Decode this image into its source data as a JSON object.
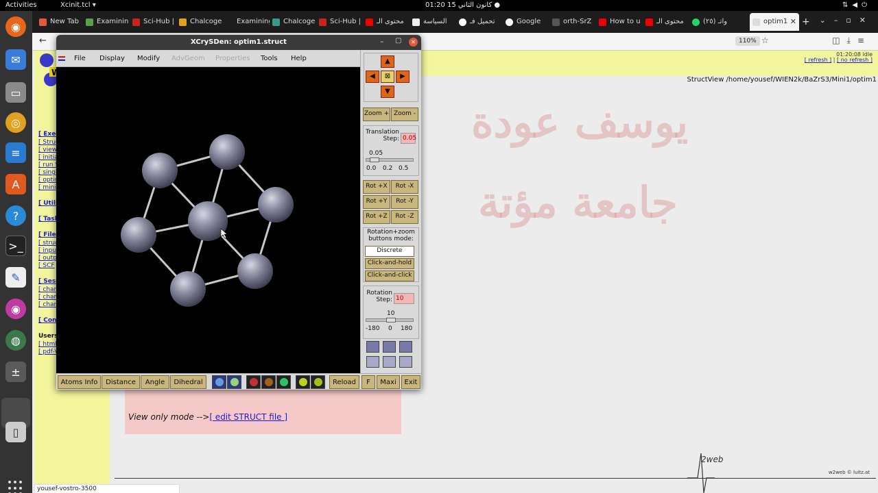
{
  "topbar": {
    "activities": "Activities",
    "app": "Xcinit.tcl ▾",
    "clock": "كانون الثاني 15  01:20  ●"
  },
  "browser": {
    "tabs": [
      {
        "label": "New Tab"
      },
      {
        "label": "Examinin"
      },
      {
        "label": "Sci-Hub |"
      },
      {
        "label": "Chalcoge"
      },
      {
        "label": "Examining t"
      },
      {
        "label": "Chalcoge"
      },
      {
        "label": "Sci-Hub |"
      },
      {
        "label": "محتوى الـ"
      },
      {
        "label": "السياسة"
      },
      {
        "label": "تحميل فـ"
      },
      {
        "label": "Google"
      },
      {
        "label": "orth-SrZ"
      },
      {
        "label": "How to u"
      },
      {
        "label": "محتوى الـ"
      },
      {
        "label": "(٢٥) واتـ"
      },
      {
        "label": "optim1"
      }
    ],
    "zoom": "110%"
  },
  "page": {
    "status_idle": "01:20:08 idle",
    "refresh": "[ refresh ]",
    "no_refresh": "[ no refresh ]",
    "structview_path": "StructView /home/yousef/WIEN2k/BaZrS3/Mini1/optim1",
    "arabic_line1": "يوسف عودة",
    "arabic_line2": "جامعة مؤتة",
    "view_only": "View only mode -->",
    "edit_link": "[ edit STRUCT file ]",
    "w2web_credit": "w2web © luitz.at",
    "w2web_logo": "2web",
    "hostname": "yousef-vostro-3500",
    "left_menu": [
      "[ Execu",
      "[ Struc",
      "[ view",
      "[ initial",
      "[ run S",
      "[ single",
      "[ optim",
      "[ mini.",
      "[ Utils.",
      "[ Tasks",
      "[ Files",
      "[ struc",
      "[ input",
      "[ outpu",
      "[ SCF",
      "[ Sessi",
      "[ chan",
      "[ chan",
      "[ chan",
      "[ Confi",
      "Usersg",
      "[ html-",
      "[ pdf-V"
    ]
  },
  "xcrysden": {
    "title": "XCrySDen: optim1.struct",
    "menu": {
      "file": "File",
      "display": "Display",
      "modify": "Modify",
      "advgeom": "AdvGeom",
      "properties": "Properties",
      "tools": "Tools",
      "help": "Help"
    },
    "zoom_in": "Zoom +",
    "zoom_out": "Zoom -",
    "translation_label": "Translation Step:",
    "translation_value": "0.05",
    "translation_slider": "0.05",
    "translation_ticks": [
      "0.0",
      "0.2",
      "0.5"
    ],
    "translation_fraction": 0.1,
    "rot_buttons": [
      "Rot +X",
      "Rot -X",
      "Rot +Y",
      "Rot -Y",
      "Rot +Z",
      "Rot -Z"
    ],
    "mode_label": "Rotation+zoom buttons mode:",
    "mode_options": [
      "Discrete",
      "Click-and-hold",
      "Click-and-click"
    ],
    "rotation_label": "Rotation Step:",
    "rotation_value": "10",
    "rotation_slider": "10",
    "rotation_ticks": [
      "-180",
      "0",
      "180"
    ],
    "rotation_fraction": 0.53,
    "bottom_buttons": {
      "atoms_info": "Atoms Info",
      "distance": "Distance",
      "angle": "Angle",
      "dihedral": "Dihedral",
      "reload": "Reload",
      "f": "F",
      "maxi": "Maxi",
      "exit": "Exit"
    }
  },
  "colors": {
    "atom": "#7f7f94",
    "bond": "#c8c8c8",
    "button_bg": "#c9b67c",
    "arrow": "#e0641a"
  }
}
